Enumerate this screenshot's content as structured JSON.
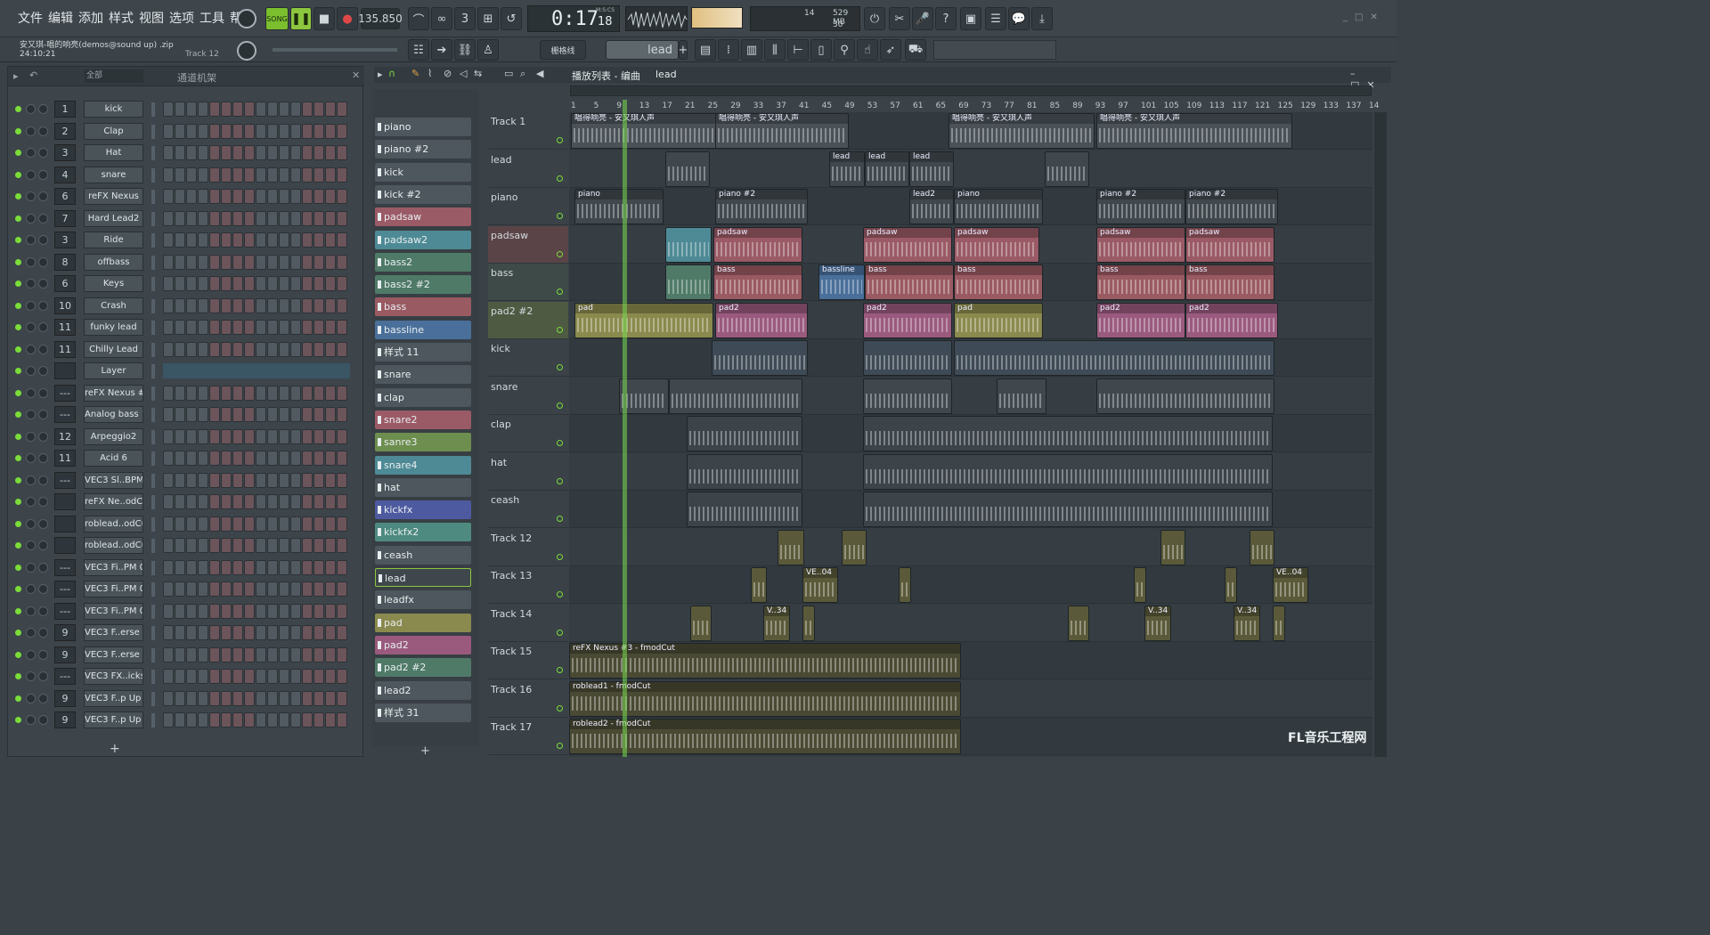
{
  "menu": [
    "文件",
    "编辑",
    "添加",
    "样式",
    "视图",
    "选项",
    "工具",
    "帮助"
  ],
  "transport": {
    "mode": "SONG",
    "tempo": "135.850",
    "time": "0:17",
    "time_small": "18",
    "time_label": "M:S:CS",
    "cpu": "14",
    "mem": "529 MB",
    "poly": "30"
  },
  "project": {
    "title": "安又琪-唱的响亮(demos@sound up) .zip",
    "timestamp": "24:10:21",
    "hint": "Track 12"
  },
  "toolbar2": {
    "snap": "栅格线",
    "pattern": "lead"
  },
  "rack": {
    "filter": "全部",
    "title": "通道机架",
    "channels": [
      {
        "num": "1",
        "name": "kick"
      },
      {
        "num": "2",
        "name": "Clap"
      },
      {
        "num": "3",
        "name": "Hat"
      },
      {
        "num": "4",
        "name": "snare"
      },
      {
        "num": "6",
        "name": "reFX Nexus"
      },
      {
        "num": "7",
        "name": "Hard Lead2"
      },
      {
        "num": "3",
        "name": "Ride"
      },
      {
        "num": "8",
        "name": "offbass"
      },
      {
        "num": "6",
        "name": "Keys"
      },
      {
        "num": "10",
        "name": "Crash"
      },
      {
        "num": "11",
        "name": "funky lead"
      },
      {
        "num": "11",
        "name": "Chilly Lead"
      },
      {
        "num": "",
        "name": "Layer"
      },
      {
        "num": "---",
        "name": "reFX Nexus #2"
      },
      {
        "num": "---",
        "name": "Analog bass 1"
      },
      {
        "num": "12",
        "name": "Arpeggio2"
      },
      {
        "num": "11",
        "name": "Acid 6"
      },
      {
        "num": "---",
        "name": "VEC3 Sl..BPM 47"
      },
      {
        "num": "",
        "name": "reFX Ne..odCut"
      },
      {
        "num": "",
        "name": "roblead..odCut"
      },
      {
        "num": "",
        "name": "roblead..odCut"
      },
      {
        "num": "---",
        "name": "VEC3 Fi..PM 001"
      },
      {
        "num": "---",
        "name": "VEC3 Fi..PM 034"
      },
      {
        "num": "---",
        "name": "VEC3 Fi..PM 012"
      },
      {
        "num": "9",
        "name": "VEC3 F..erse 07"
      },
      {
        "num": "9",
        "name": "VEC3 F..erse 01"
      },
      {
        "num": "---",
        "name": "VEC3 FX..icks 29"
      },
      {
        "num": "9",
        "name": "VEC3 F..p Up 20"
      },
      {
        "num": "9",
        "name": "VEC3 F..p Up 27"
      }
    ]
  },
  "playlist": {
    "title": "播放列表 - 编曲",
    "crumb": "lead",
    "patterns": [
      {
        "name": "piano",
        "color": "#4e575d"
      },
      {
        "name": "piano #2",
        "color": "#4e575d"
      },
      {
        "name": "kick",
        "color": "#4e575d"
      },
      {
        "name": "kick #2",
        "color": "#4e575d"
      },
      {
        "name": "padsaw",
        "color": "#9a5a66"
      },
      {
        "name": "padsaw2",
        "color": "#4e8a95"
      },
      {
        "name": "bass2",
        "color": "#4f7a68"
      },
      {
        "name": "bass2 #2",
        "color": "#4f7a68"
      },
      {
        "name": "bass",
        "color": "#9a5a62"
      },
      {
        "name": "bassline",
        "color": "#4a6f9a"
      },
      {
        "name": "样式 11",
        "color": "#4e575d"
      },
      {
        "name": "snare",
        "color": "#4e575d"
      },
      {
        "name": "clap",
        "color": "#4e575d"
      },
      {
        "name": "snare2",
        "color": "#9a5a66"
      },
      {
        "name": "sanre3",
        "color": "#6d8e4e"
      },
      {
        "name": "snare4",
        "color": "#4e8a95"
      },
      {
        "name": "hat",
        "color": "#4e575d"
      },
      {
        "name": "kickfx",
        "color": "#4e5aa0"
      },
      {
        "name": "kickfx2",
        "color": "#4e8a80"
      },
      {
        "name": "ceash",
        "color": "#4e575d"
      },
      {
        "name": "lead",
        "color": "#3f474c"
      },
      {
        "name": "leadfx",
        "color": "#4e575d"
      },
      {
        "name": "pad",
        "color": "#8a8a4e"
      },
      {
        "name": "pad2",
        "color": "#9a5a7e"
      },
      {
        "name": "pad2 #2",
        "color": "#4f7a68"
      },
      {
        "name": "lead2",
        "color": "#4e575d"
      },
      {
        "name": "样式 31",
        "color": "#4e575d"
      }
    ],
    "tracks": [
      "Track 1",
      "lead",
      "piano",
      "padsaw",
      "bass",
      "pad2 #2",
      "kick",
      "snare",
      "clap",
      "hat",
      "ceash",
      "Track 12",
      "Track 13",
      "Track 14",
      "Track 15",
      "Track 16",
      "Track 17"
    ],
    "ruler": [
      "1",
      "5",
      "9",
      "13",
      "17",
      "21",
      "25",
      "29",
      "33",
      "37",
      "41",
      "45",
      "49",
      "53",
      "57",
      "61",
      "65",
      "69",
      "73",
      "77",
      "81",
      "85",
      "89",
      "93",
      "97",
      "101",
      "105",
      "109",
      "113",
      "117",
      "121",
      "125",
      "129",
      "133",
      "137",
      "14"
    ],
    "clip_labels": {
      "audio": "唱得响亮 - 安又琪人声",
      "lead": "lead",
      "lead2": "lead2",
      "piano": "piano",
      "piano2": "piano #2",
      "padsaw": "padsaw",
      "bass": "bass",
      "bassline": "bassline",
      "pad": "pad",
      "pad2": "pad2",
      "ve04": "VE..04",
      "v34": "V..34",
      "auto1": "reFX Nexus #3 - fmodCut",
      "auto2": "roblead1 - fmodCut",
      "auto3": "roblead2 - fmodCut"
    }
  },
  "watermark": "FL音乐工程网"
}
